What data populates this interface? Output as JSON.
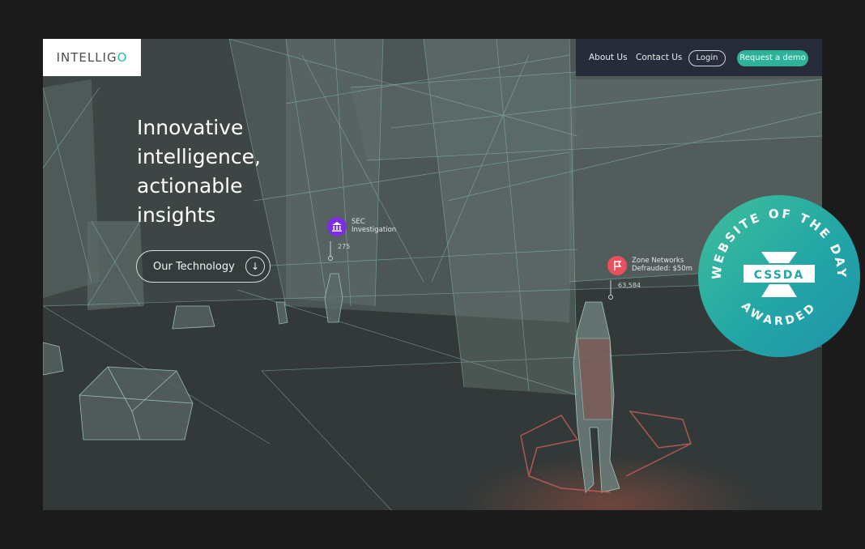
{
  "header": {
    "logo_text": "INTELLIG",
    "logo_last_letter": "O",
    "nav": {
      "about": "About Us",
      "contact": "Contact Us",
      "login": "Login",
      "demo": "Request a demo"
    }
  },
  "hero": {
    "headline_lines": [
      "Innovative",
      "intelligence,",
      "actionable",
      "insights"
    ],
    "cta_label": "Our Technology",
    "cta_icon": "arrow-down-icon"
  },
  "pins": [
    {
      "title": "SEC",
      "subtitle": "Investigation",
      "value": "275",
      "color": "#7b2fe0",
      "icon": "bank-icon"
    },
    {
      "title": "Zone Networks",
      "subtitle": "Defrauded: $50m",
      "value": "63,584",
      "color": "#e8505b",
      "icon": "flag-icon"
    }
  ],
  "badge": {
    "top_text": "WEBSITE OF THE DAY",
    "center_text": "CSSDA",
    "bottom_text": "AWARDED"
  },
  "colors": {
    "accent": "#2fb29a",
    "nav_bg": "#272c3a",
    "wireframe": "#8fc7c2",
    "page_bg": "#1b1b1b"
  }
}
